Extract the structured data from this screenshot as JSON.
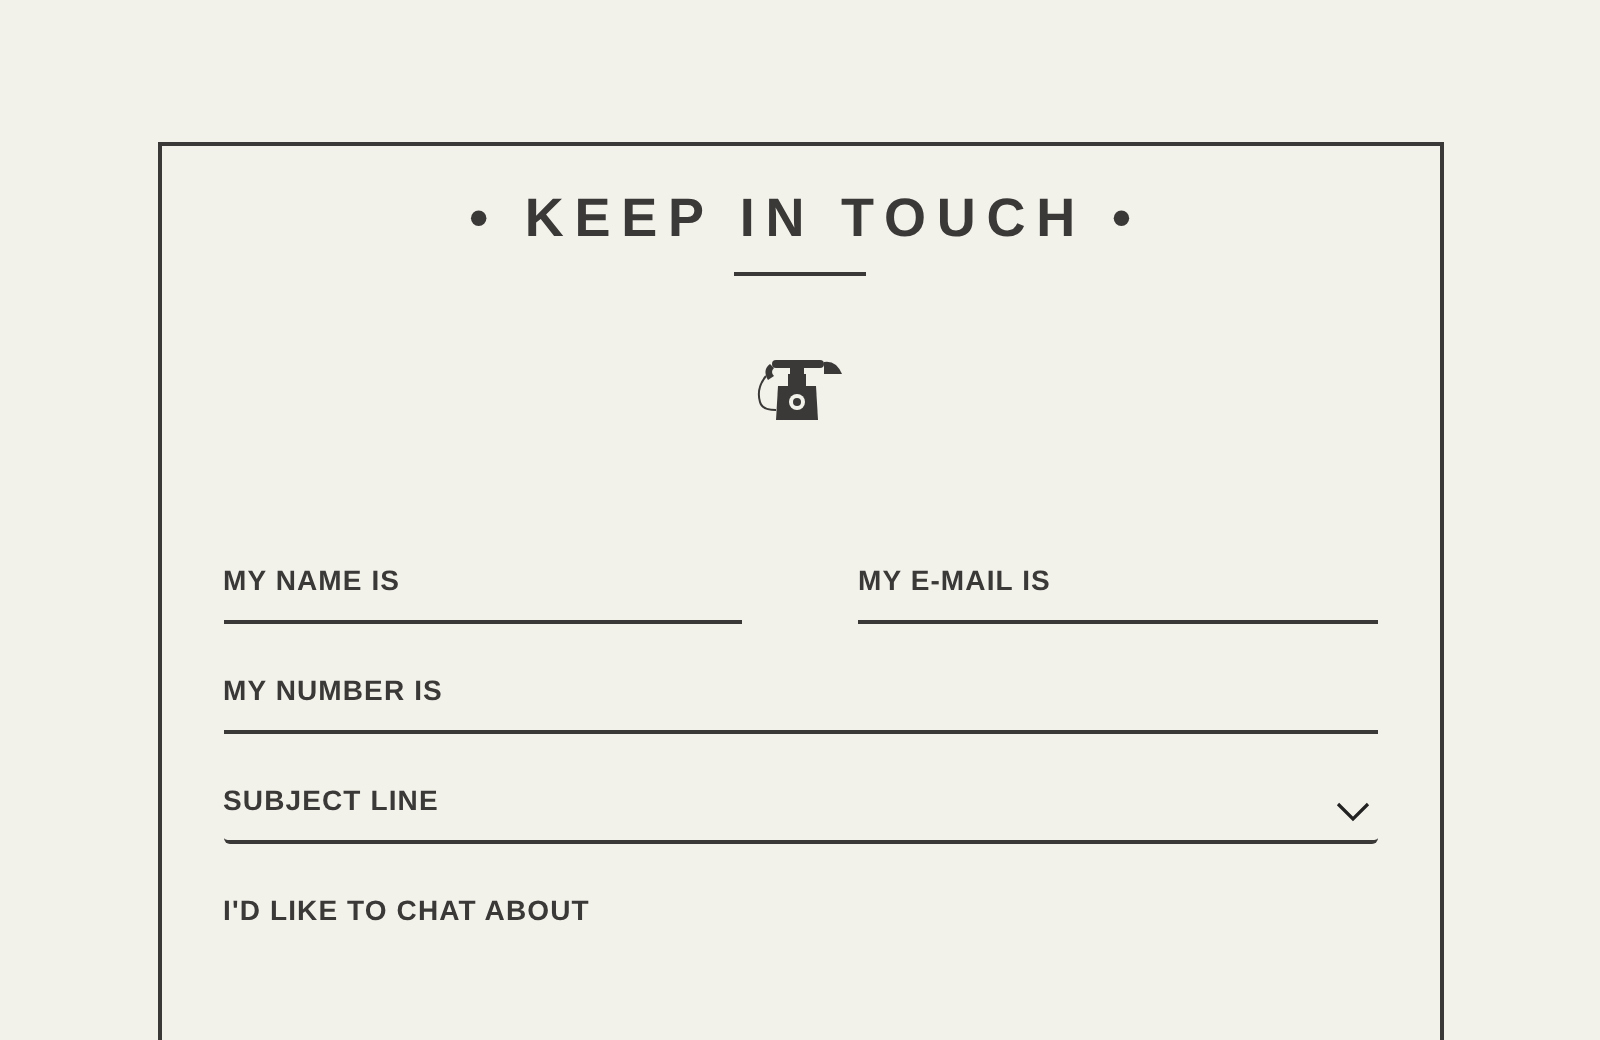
{
  "title": "• KEEP IN TOUCH •",
  "rows": [
    [
      {
        "kind": "text",
        "placeholder": "MY NAME IS"
      },
      {
        "kind": "text",
        "placeholder": "MY E-MAIL IS"
      }
    ],
    [
      {
        "kind": "text",
        "placeholder": "MY NUMBER IS"
      }
    ],
    [
      {
        "kind": "select",
        "placeholder": "SUBJECT LINE"
      }
    ],
    [
      {
        "kind": "textarea",
        "placeholder": "I'D LIKE TO CHAT ABOUT"
      }
    ]
  ]
}
